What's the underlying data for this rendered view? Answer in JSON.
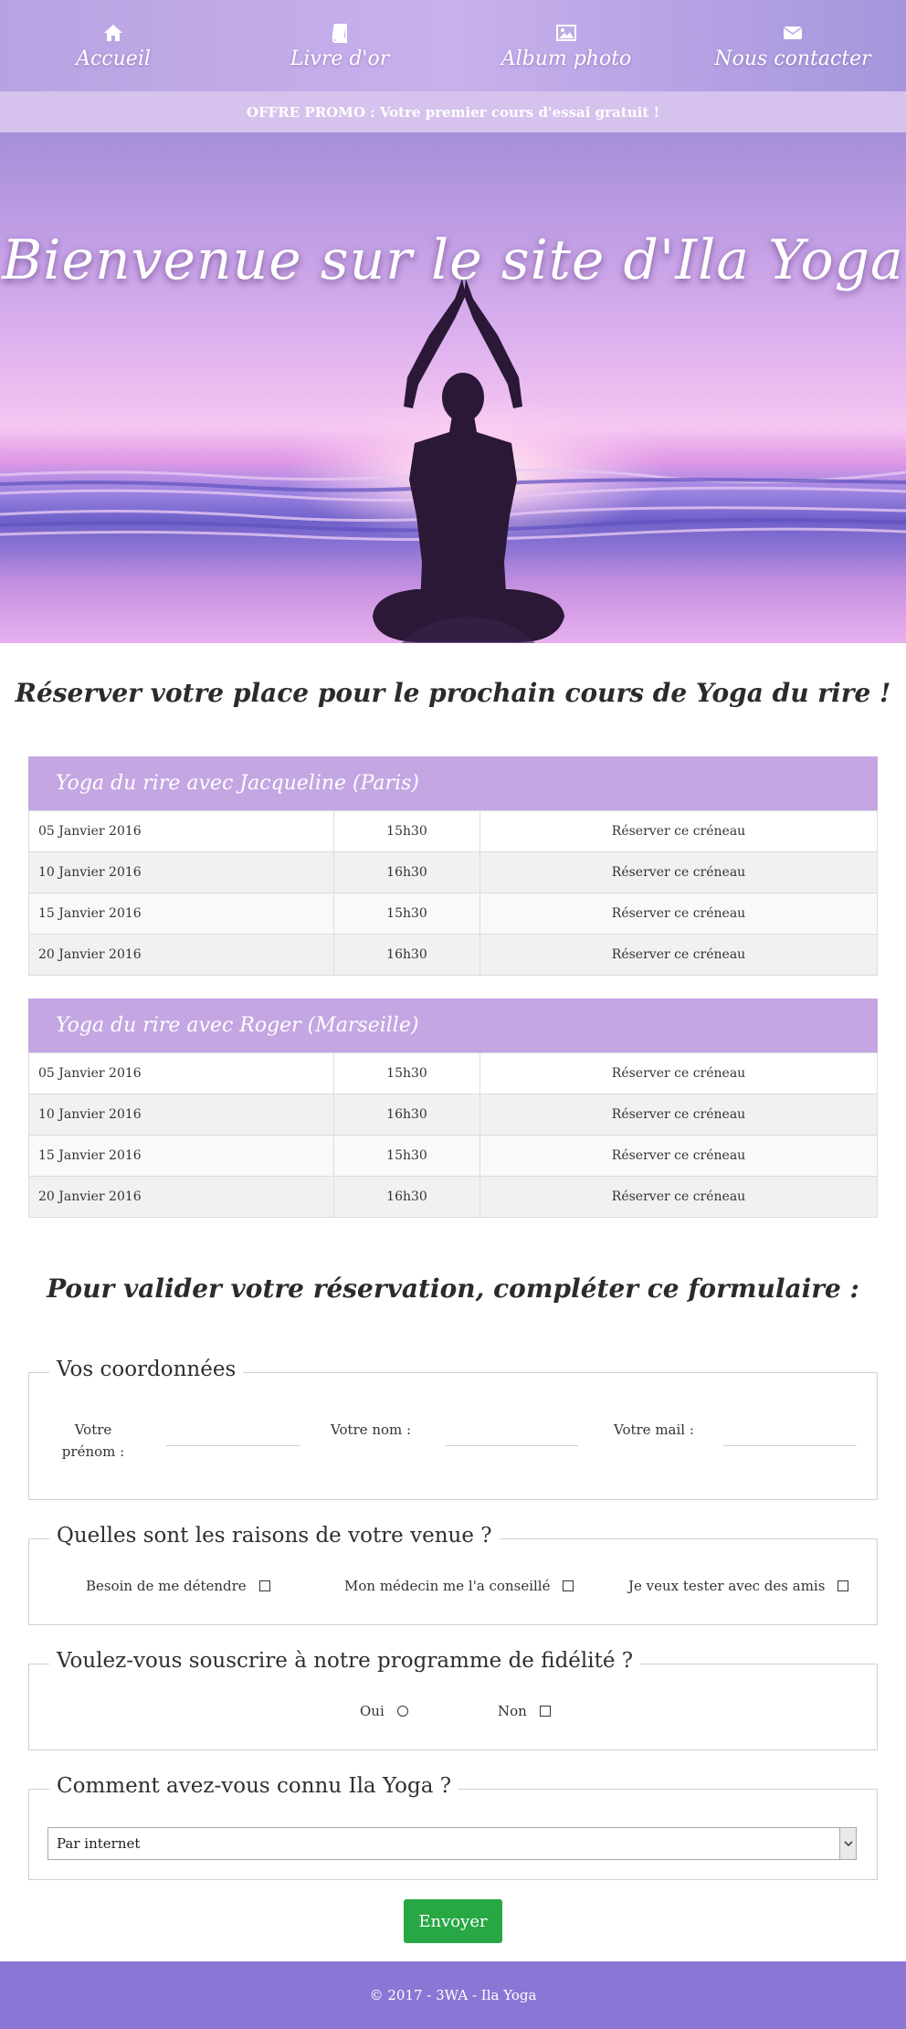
{
  "nav": {
    "items": [
      {
        "label": "Accueil",
        "icon": "home-icon"
      },
      {
        "label": "Livre d'or",
        "icon": "book-icon"
      },
      {
        "label": "Album photo",
        "icon": "image-icon"
      },
      {
        "label": "Nous contacter",
        "icon": "envelope-icon"
      }
    ]
  },
  "promo": "OFFRE PROMO : Votre premier cours d'essai gratuit !",
  "hero": {
    "title": "Bienvenue sur le site d'Ila Yoga"
  },
  "booking": {
    "title": "Réserver votre place pour le prochain cours de Yoga du rire !",
    "groups": [
      {
        "title": "Yoga du rire avec Jacqueline (Paris)",
        "rows": [
          {
            "date": "05 Janvier 2016",
            "time": "15h30",
            "action": "Réserver ce créneau"
          },
          {
            "date": "10 Janvier 2016",
            "time": "16h30",
            "action": "Réserver ce créneau"
          },
          {
            "date": "15 Janvier 2016",
            "time": "15h30",
            "action": "Réserver ce créneau"
          },
          {
            "date": "20 Janvier 2016",
            "time": "16h30",
            "action": "Réserver ce créneau"
          }
        ]
      },
      {
        "title": "Yoga du rire avec Roger (Marseille)",
        "rows": [
          {
            "date": "05 Janvier 2016",
            "time": "15h30",
            "action": "Réserver ce créneau"
          },
          {
            "date": "10 Janvier 2016",
            "time": "16h30",
            "action": "Réserver ce créneau"
          },
          {
            "date": "15 Janvier 2016",
            "time": "15h30",
            "action": "Réserver ce créneau"
          },
          {
            "date": "20 Janvier 2016",
            "time": "16h30",
            "action": "Réserver ce créneau"
          }
        ]
      }
    ]
  },
  "form": {
    "title": "Pour valider votre réservation, compléter ce formulaire :",
    "coords": {
      "legend": "Vos coordonnées",
      "firstname_label": "Votre prénom :",
      "lastname_label": "Votre nom :",
      "email_label": "Votre mail :"
    },
    "reasons": {
      "legend": "Quelles sont les raisons de votre venue ?",
      "options": [
        "Besoin de me détendre",
        "Mon médecin me l'a conseillé",
        "Je veux tester avec des amis"
      ]
    },
    "loyalty": {
      "legend": "Voulez-vous souscrire à notre programme de fidélité ?",
      "yes": "Oui",
      "no": "Non"
    },
    "source": {
      "legend": "Comment avez-vous connu Ila Yoga ?",
      "selected": "Par internet"
    },
    "submit": "Envoyer"
  },
  "footer": "© 2017 - 3WA - Ila Yoga",
  "colors": {
    "nav": "#b7a3e2",
    "promo": "#d5c2ed",
    "panel_head": "#c3a6e2",
    "link": "#2f6dcf",
    "submit": "#28a745",
    "footer": "#8b76d5"
  }
}
